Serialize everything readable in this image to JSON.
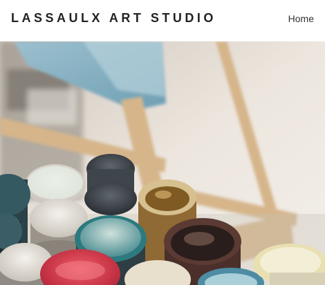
{
  "header": {
    "site_title": "LASSAULX ART STUDIO",
    "nav": {
      "home_label": "Home"
    }
  },
  "hero": {
    "image_subject": "paint-jars-and-easel-photo",
    "colors": {
      "background_wall": "#efeae4",
      "easel_wood": "#d8b88f",
      "canvas_blue": "#8fb3c4",
      "jar_red": "#d9364a",
      "jar_teal": "#2f7e86",
      "jar_ochre": "#a8864a",
      "jar_dark": "#3b4146"
    }
  }
}
